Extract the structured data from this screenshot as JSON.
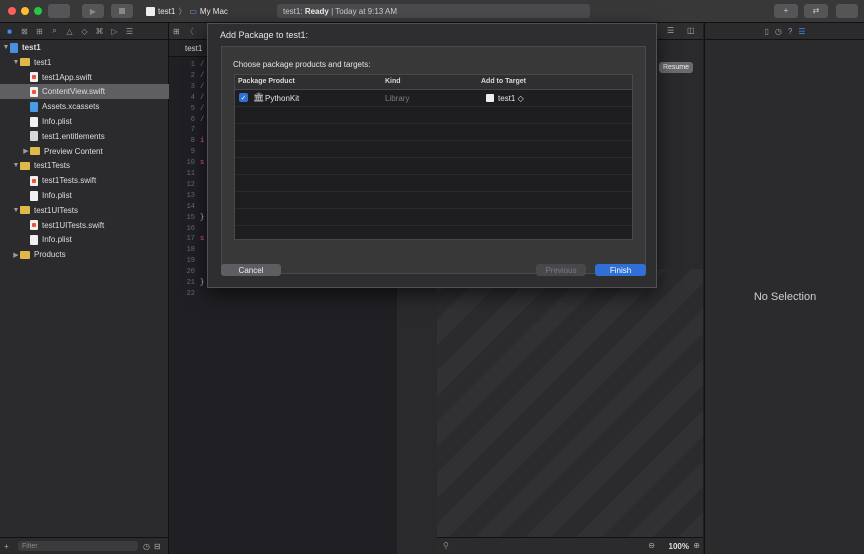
{
  "window": {
    "scheme_target": "test1",
    "scheme_device": "My Mac",
    "status_project": "test1:",
    "status_state": "Ready",
    "status_time": "| Today at 9:13 AM"
  },
  "navigator": {
    "items": [
      {
        "label": "test1",
        "type": "project",
        "indent": 0,
        "open": true
      },
      {
        "label": "test1",
        "type": "folder",
        "indent": 1,
        "open": true
      },
      {
        "label": "test1App.swift",
        "type": "swift",
        "indent": 2
      },
      {
        "label": "ContentView.swift",
        "type": "swift",
        "indent": 2,
        "selected": true
      },
      {
        "label": "Assets.xcassets",
        "type": "assets",
        "indent": 2
      },
      {
        "label": "Info.plist",
        "type": "plist",
        "indent": 2
      },
      {
        "label": "test1.entitlements",
        "type": "entitlements",
        "indent": 2
      },
      {
        "label": "Preview Content",
        "type": "folder",
        "indent": 2,
        "open": false
      },
      {
        "label": "test1Tests",
        "type": "folder",
        "indent": 1,
        "open": true
      },
      {
        "label": "test1Tests.swift",
        "type": "swift",
        "indent": 2
      },
      {
        "label": "Info.plist",
        "type": "plist",
        "indent": 2
      },
      {
        "label": "test1UITests",
        "type": "folder",
        "indent": 1,
        "open": true
      },
      {
        "label": "test1UITests.swift",
        "type": "swift",
        "indent": 2
      },
      {
        "label": "Info.plist",
        "type": "plist",
        "indent": 2
      },
      {
        "label": "Products",
        "type": "folder",
        "indent": 1,
        "open": false
      }
    ],
    "filter_placeholder": "Filter"
  },
  "editor": {
    "breadcrumb": "test1",
    "line_numbers": [
      "1",
      "2",
      "3",
      "4",
      "5",
      "6",
      "7",
      "8",
      "9",
      "10",
      "11",
      "12",
      "13",
      "14",
      "15",
      "16",
      "17",
      "18",
      "19",
      "20",
      "21",
      "22"
    ],
    "code_fragments": [
      {
        "line": 1,
        "text": "/"
      },
      {
        "line": 2,
        "text": "/"
      },
      {
        "line": 3,
        "text": "/"
      },
      {
        "line": 4,
        "text": "/"
      },
      {
        "line": 5,
        "text": "/"
      },
      {
        "line": 6,
        "text": "/"
      },
      {
        "line": 8,
        "text": "i"
      },
      {
        "line": 10,
        "text": "s"
      },
      {
        "line": 15,
        "text": "}"
      },
      {
        "line": 17,
        "text": "s"
      },
      {
        "line": 21,
        "text": "}"
      }
    ]
  },
  "canvas": {
    "resume_label": "Resume",
    "zoom": "100%"
  },
  "inspector": {
    "empty_label": "No Selection"
  },
  "sheet": {
    "title": "Add Package to test1:",
    "prompt": "Choose package products and targets:",
    "columns": [
      "Package Product",
      "Kind",
      "Add to Target"
    ],
    "rows": [
      {
        "checked": true,
        "product": "PythonKit",
        "kind": "Library",
        "target": "test1 ◇"
      }
    ],
    "cancel_label": "Cancel",
    "previous_label": "Previous",
    "finish_label": "Finish"
  },
  "colors": {
    "accent": "#2f6fd6",
    "close": "#ff5f57",
    "minimize": "#febc2e",
    "zoom": "#28c840"
  }
}
